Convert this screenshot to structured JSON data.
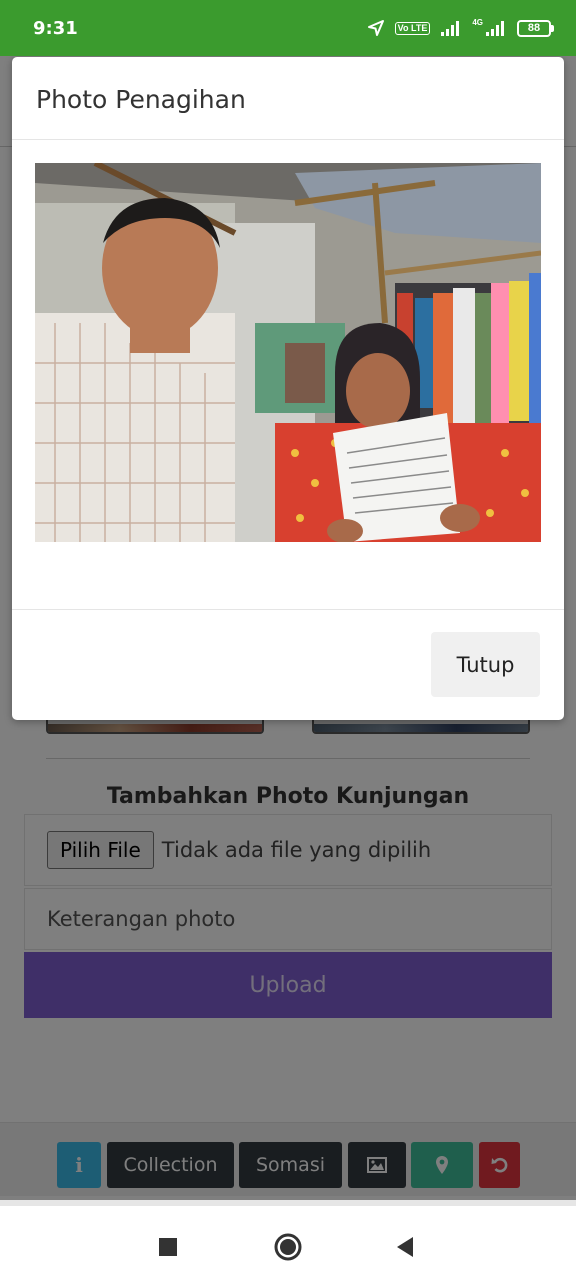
{
  "status_bar": {
    "time": "9:31",
    "network_label": "Vo LTE",
    "network2_label": "4G",
    "battery": "88",
    "icons": [
      "location-arrow-icon",
      "volte-icon",
      "signal-icon",
      "signal-4g-icon",
      "battery-icon"
    ]
  },
  "modal": {
    "title": "Photo Penagihan",
    "close_label": "Tutup"
  },
  "page": {
    "add_photo_title": "Tambahkan Photo Kunjungan",
    "file_button_label": "Pilih File",
    "file_status": "Tidak ada file yang dipilih",
    "description_placeholder": "Keterangan photo",
    "upload_label": "Upload"
  },
  "toolbar": {
    "info_label": "i",
    "collection_label": "Collection",
    "somasi_label": "Somasi",
    "icons": [
      "info-icon",
      "image-icon",
      "map-marker-icon",
      "undo-icon"
    ]
  },
  "colors": {
    "status_bar": "#3b9b2e",
    "upload": "#7e5fd1",
    "info": "#3bbbe9",
    "dark": "#333a40",
    "map": "#3fbf9b",
    "reset": "#e0353f"
  },
  "nav_bar": {
    "icons": [
      "recents-square-icon",
      "home-circle-icon",
      "back-triangle-icon"
    ]
  }
}
